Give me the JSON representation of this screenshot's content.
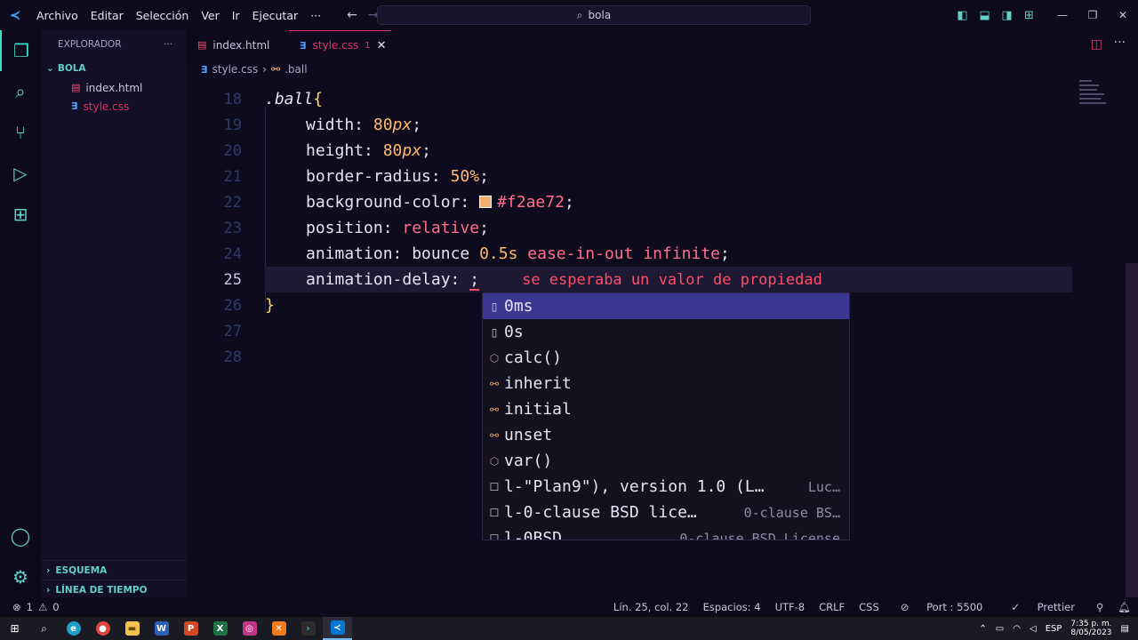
{
  "menu": [
    "Archivo",
    "Editar",
    "Selección",
    "Ver",
    "Ir",
    "Ejecutar",
    "···"
  ],
  "search": {
    "text": "bola"
  },
  "explorer": {
    "title": "EXPLORADOR",
    "more": "···",
    "folder": "BOLA",
    "files": [
      {
        "name": "index.html",
        "type": "html"
      },
      {
        "name": "style.css",
        "type": "css"
      }
    ],
    "outline": "ESQUEMA",
    "timeline": "LÍNEA DE TIEMPO"
  },
  "tabs": [
    {
      "name": "index.html",
      "type": "html",
      "active": false
    },
    {
      "name": "style.css",
      "type": "css",
      "active": true,
      "marker": "1"
    }
  ],
  "breadcrumb": {
    "file": "style.css",
    "symbol": ".ball"
  },
  "code": {
    "line18": {
      "num": "18",
      "selector": ".ball",
      "brace": "{"
    },
    "line19": {
      "num": "19",
      "prop": "width: ",
      "value": "80",
      "unit": "px",
      "end": ";"
    },
    "line20": {
      "num": "20",
      "prop": "height: ",
      "value": "80",
      "unit": "px",
      "end": ";"
    },
    "line21": {
      "num": "21",
      "prop": "border-radius: ",
      "value": "50",
      "unit": "%",
      "end": ";"
    },
    "line22": {
      "num": "22",
      "prop": "background-color: ",
      "value": "#f2ae72",
      "end": ";"
    },
    "line23": {
      "num": "23",
      "prop": "position: ",
      "value": "relative",
      "end": ";"
    },
    "line24": {
      "num": "24",
      "prop": "animation: ",
      "name": "bounce ",
      "duration": "0.5s",
      "rest": " ease-in-out infinite",
      "end": ";"
    },
    "line25": {
      "num": "25",
      "prop": "animation-delay: ",
      "end": ";",
      "error": "se esperaba un valor de propiedad"
    },
    "line26": {
      "num": "26",
      "brace": "}"
    },
    "line27": {
      "num": "27"
    },
    "line28": {
      "num": "28"
    }
  },
  "suggestions": [
    {
      "label": "0ms",
      "kind": "value",
      "active": true,
      "detail": ""
    },
    {
      "label": "0s",
      "kind": "value",
      "active": false,
      "detail": ""
    },
    {
      "label": "calc()",
      "kind": "function",
      "active": false,
      "detail": ""
    },
    {
      "label": "inherit",
      "kind": "keyword",
      "active": false,
      "detail": ""
    },
    {
      "label": "initial",
      "kind": "keyword",
      "active": false,
      "detail": ""
    },
    {
      "label": "unset",
      "kind": "keyword",
      "active": false,
      "detail": ""
    },
    {
      "label": "var()",
      "kind": "function",
      "active": false,
      "detail": ""
    },
    {
      "label": "l-\"Plan9\"), version 1.0 (L…",
      "kind": "snippet",
      "active": false,
      "detail": "Luc…"
    },
    {
      "label": "l-0-clause BSD lice…",
      "kind": "snippet",
      "active": false,
      "detail": "0-clause BS…"
    },
    {
      "label": "l-0BSD",
      "kind": "snippet",
      "active": false,
      "detail": "0-clause BSD License"
    }
  ],
  "status": {
    "errors": "1",
    "warnings": "0",
    "position": "Lín. 25, col. 22",
    "spaces": "Espacios: 4",
    "encoding": "UTF-8",
    "eol": "CRLF",
    "language": "CSS",
    "port": "Port : 5500",
    "prettier": "Prettier"
  },
  "taskbar": {
    "lang": "ESP",
    "time": "7:35 p. m.",
    "date": "8/05/2023"
  },
  "colors": {
    "accent": "#38e0c5",
    "error": "#ff4d6a",
    "swatch": "#f2ae72"
  }
}
